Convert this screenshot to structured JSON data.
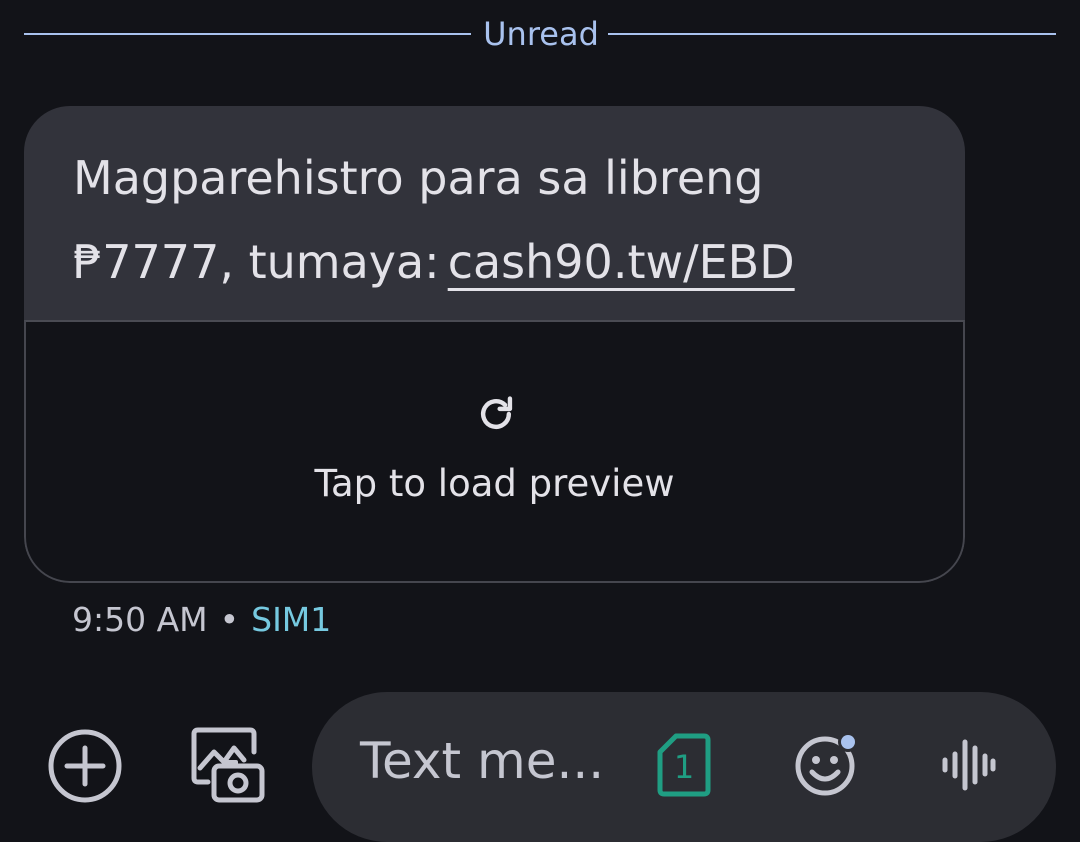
{
  "divider": {
    "label": "Unread"
  },
  "message": {
    "text": "Magparehistro para sa libreng ₱7777, tumaya:",
    "link": "cash90.tw/EBD",
    "preview_label": "Tap to load preview",
    "time": "9:50 AM",
    "separator": "•",
    "sim": "SIM1"
  },
  "compose": {
    "placeholder": "Text me...",
    "sim_number": "1",
    "icons": [
      "add-icon",
      "gallery-camera-icon",
      "sim-card-icon",
      "emoji-icon",
      "voice-icon",
      "refresh-icon"
    ]
  },
  "colors": {
    "background": "#121318",
    "bubble": "#32333b",
    "accent_divider": "#a9c2ee",
    "sim_label": "#76c9e0",
    "sim_icon": "#1f9e83",
    "emoji_dot": "#a9c2ee"
  }
}
